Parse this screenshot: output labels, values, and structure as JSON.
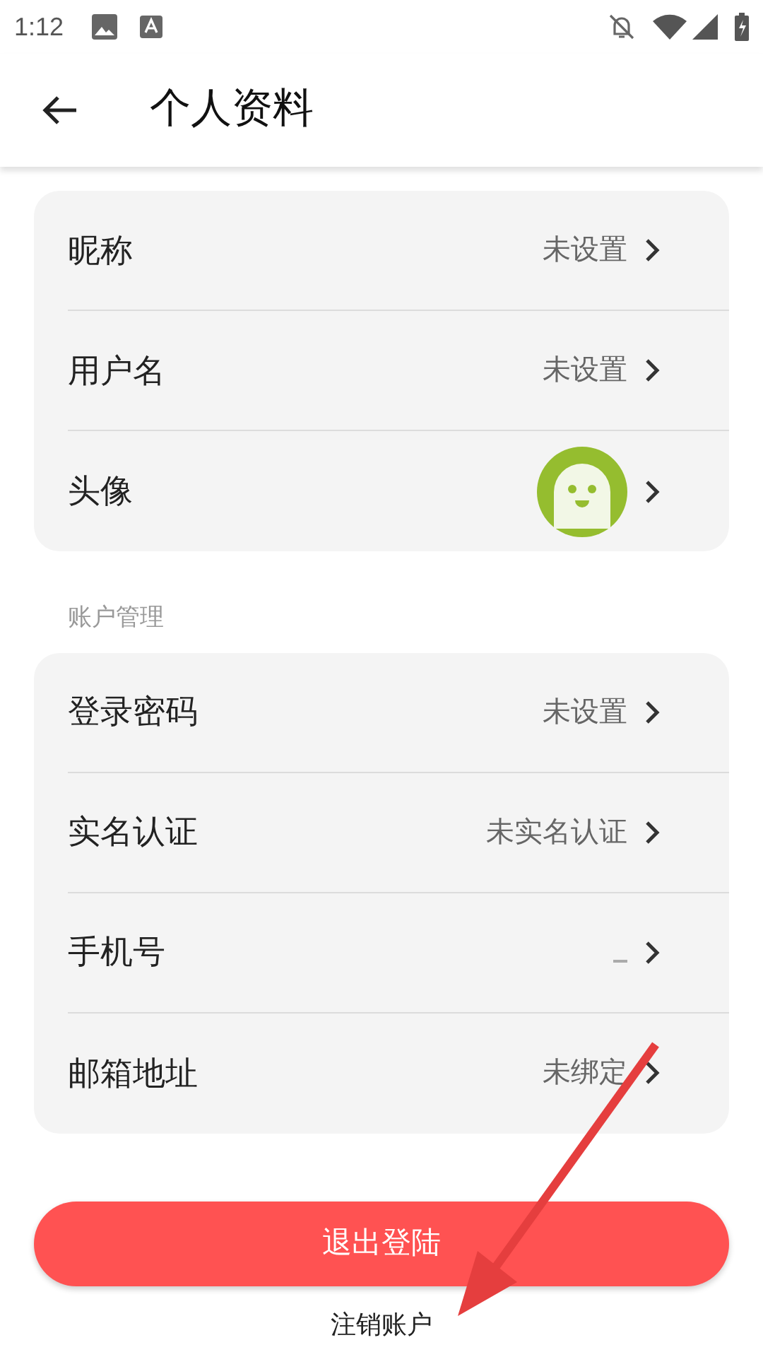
{
  "status_bar": {
    "time": "1:12"
  },
  "header": {
    "title": "个人资料"
  },
  "profile_rows": [
    {
      "kind": "text",
      "label": "昵称",
      "value": "未设置"
    },
    {
      "kind": "text",
      "label": "用户名",
      "value": "未设置"
    },
    {
      "kind": "avatar",
      "label": "头像"
    }
  ],
  "account_section": {
    "title": "账户管理",
    "rows": [
      {
        "kind": "text",
        "label": "登录密码",
        "value": "未设置"
      },
      {
        "kind": "text",
        "label": "实名认证",
        "value": "未实名认证"
      },
      {
        "kind": "masked",
        "label": "手机号"
      },
      {
        "kind": "text",
        "label": "邮箱地址",
        "value": "未绑定"
      }
    ]
  },
  "logout_button": "退出登陆",
  "cancel_account_link": "注销账户"
}
